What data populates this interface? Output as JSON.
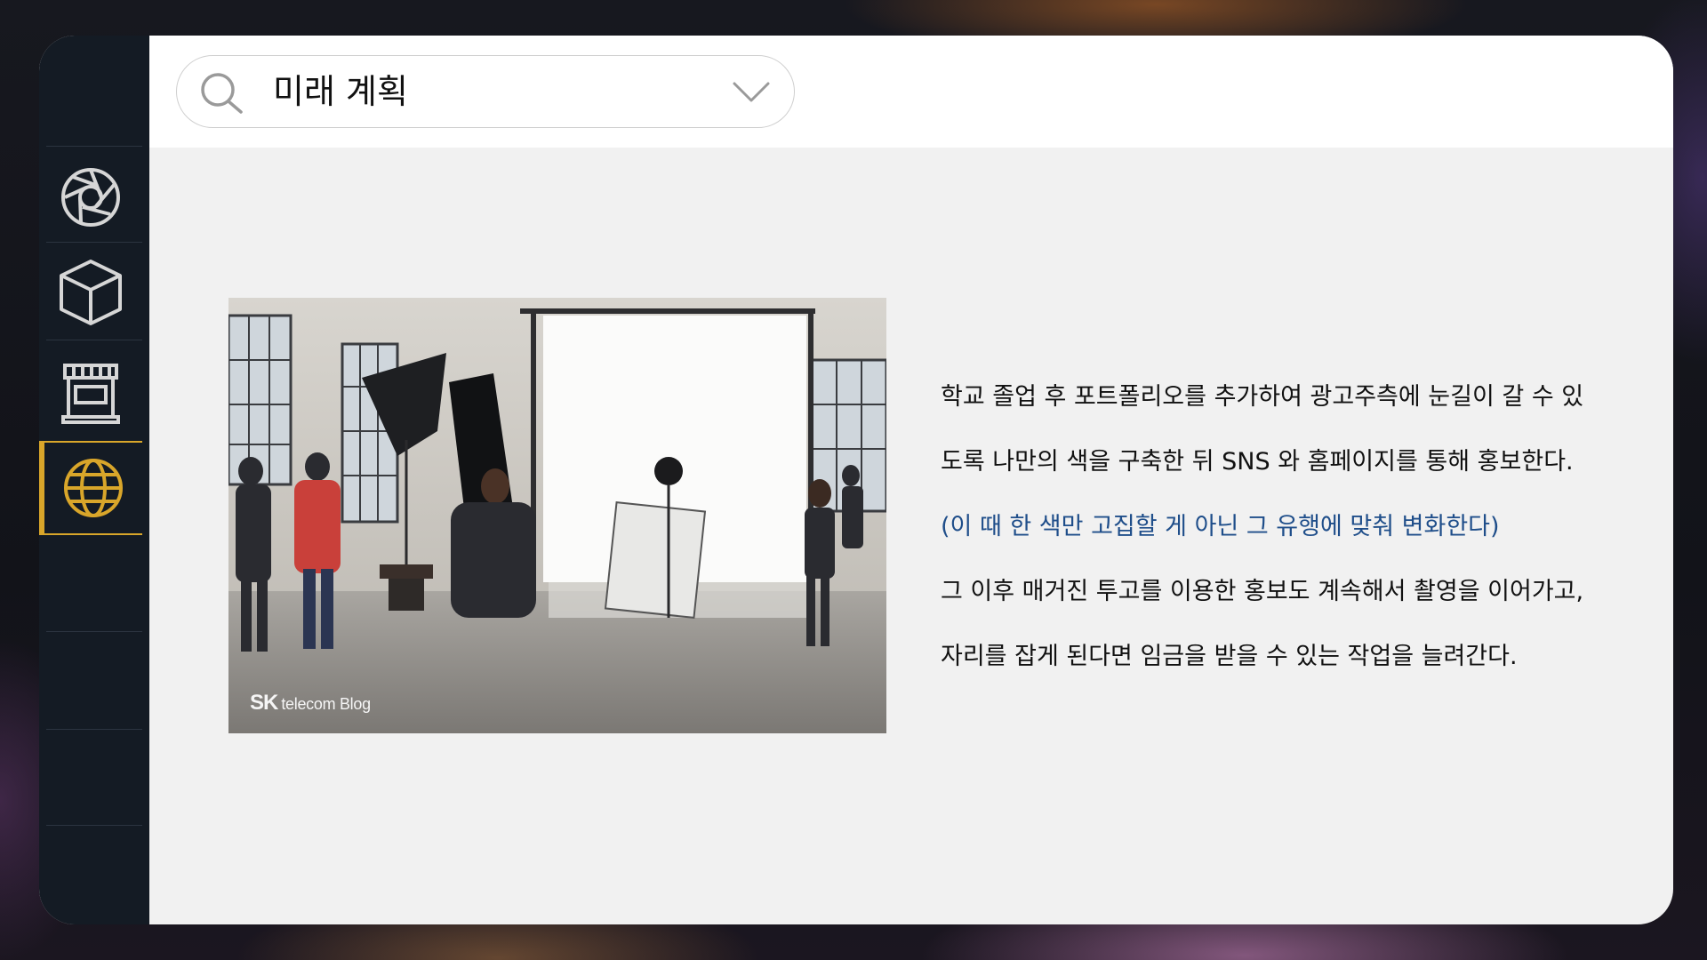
{
  "search": {
    "value": "미래 계획"
  },
  "sidebar": {
    "items": [
      {
        "icon": "aperture-icon",
        "active": false
      },
      {
        "icon": "cube-icon",
        "active": false
      },
      {
        "icon": "storefront-icon",
        "active": false
      },
      {
        "icon": "globe-icon",
        "active": true
      }
    ]
  },
  "photo": {
    "caption_brand": "SK",
    "caption_text": "telecom Blog"
  },
  "content": {
    "lines": [
      "학교 졸업 후 포트폴리오를 추가하여 광고주측에 눈길이 갈 수 있",
      "도록 나만의 색을 구축한 뒤 SNS 와 홈페이지를 통해 홍보한다.",
      "(이 때 한 색만 고집할 게 아닌 그 유행에 맞춰 변화한다)",
      "그 이후 매거진 투고를 이용한 홍보도 계속해서 촬영을 이어가고,",
      "자리를 잡게 된다면 임금을 받을 수 있는 작업을 늘려간다."
    ]
  },
  "colors": {
    "accent": "#d9a62a",
    "sidebar_bg": "#141b24",
    "highlight_text": "#1f4e8a"
  }
}
